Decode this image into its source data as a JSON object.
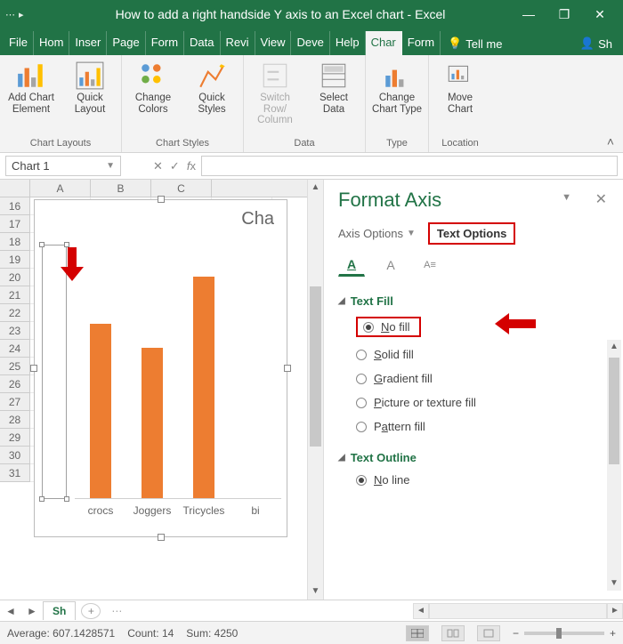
{
  "titlebar": {
    "title": "How to add a right handside Y axis to an Excel chart  -  Excel"
  },
  "window": {
    "minimize": "—",
    "restore": "❐",
    "close": "✕"
  },
  "tabs": {
    "file": "File",
    "list": [
      "Hom",
      "Inser",
      "Page",
      "Form",
      "Data",
      "Revi",
      "View",
      "Deve",
      "Help",
      "Char",
      "Form"
    ],
    "active": "Char",
    "tellme": "Tell me",
    "share": "Sh"
  },
  "ribbon": {
    "groups": {
      "chart_layouts": {
        "label": "Chart Layouts",
        "add_chart_element": "Add Chart Element",
        "quick_layout": "Quick Layout"
      },
      "chart_styles": {
        "label": "Chart Styles",
        "change_colors": "Change Colors",
        "quick_styles": "Quick Styles"
      },
      "data": {
        "label": "Data",
        "switch": "Switch Row/ Column",
        "select_data": "Select Data"
      },
      "type": {
        "label": "Type",
        "change_type": "Change Chart Type"
      },
      "location": {
        "label": "Location",
        "move_chart": "Move Chart"
      }
    }
  },
  "namebox": "Chart 1",
  "columns": [
    "A",
    "B",
    "C"
  ],
  "row_start": 16,
  "row_end": 31,
  "chart_title_partial": "Cha",
  "chart_data": {
    "type": "bar",
    "title": "Cha",
    "categories": [
      "crocs",
      "Joggers",
      "Tricycles",
      "bi"
    ],
    "values": [
      1100,
      950,
      1400,
      null
    ],
    "ylim": [
      0,
      1600
    ],
    "xlabel": "",
    "ylabel": ""
  },
  "format_pane": {
    "title": "Format Axis",
    "axis_options": "Axis Options",
    "text_options": "Text Options",
    "text_fill": {
      "header": "Text Fill",
      "options": {
        "no_fill": "No fill",
        "solid": "Solid fill",
        "gradient": "Gradient fill",
        "picture": "Picture or texture fill",
        "pattern": "Pattern fill"
      },
      "selected": "no_fill"
    },
    "text_outline": {
      "header": "Text Outline",
      "options": {
        "no_line": "No line"
      },
      "selected": "no_line"
    }
  },
  "sheet_tab": "Sh",
  "status": {
    "average_label": "Average:",
    "average": "607.1428571",
    "count_label": "Count:",
    "count": "14",
    "sum_label": "Sum:",
    "sum": "4250"
  }
}
